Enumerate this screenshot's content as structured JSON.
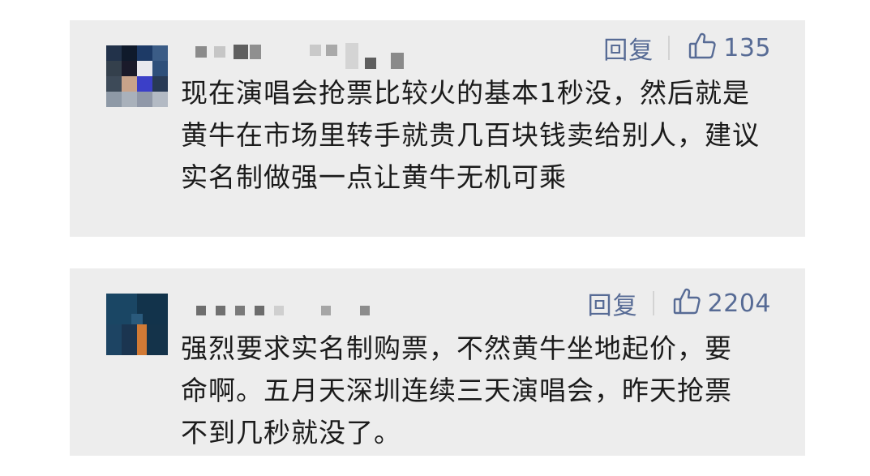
{
  "comments": [
    {
      "username_hidden": true,
      "reply_label": "回复",
      "like_icon": "thumbs-up-icon",
      "like_count": "135",
      "text": "现在演唱会抢票比较火的基本1秒没，然后就是黄牛在市场里转手就贵几百块钱卖给别人，建议实名制做强一点让黄牛无机可乘"
    },
    {
      "username_hidden": true,
      "reply_label": "回复",
      "like_icon": "thumbs-up-icon",
      "like_count": "2204",
      "text": "强烈要求实名制购票，不然黄牛坐地起价，要命啊。五月天深圳连续三天演唱会，昨天抢票不到几秒就没了。"
    }
  ],
  "colors": {
    "card_bg": "#ededed",
    "action_blue": "#576b95",
    "text": "#1b1b1b"
  }
}
